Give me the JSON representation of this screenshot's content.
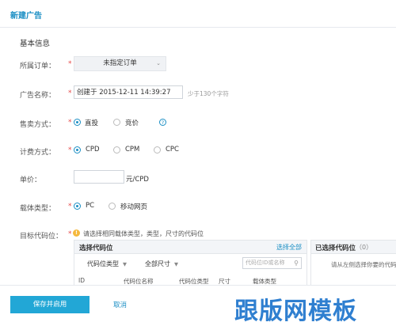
{
  "header": {
    "title": "新建广告"
  },
  "section_title": "基本信息",
  "form": {
    "order": {
      "label": "所属订单：",
      "required": "*",
      "value": "未指定订单",
      "caret": "⌄"
    },
    "ad_name": {
      "label": "广告名称：",
      "required": "*",
      "value": "创建于 2015-12-11 14:39:27",
      "hint": "少于130个字符"
    },
    "sale_method": {
      "label": "售卖方式：",
      "required": "*",
      "options": [
        "直投",
        "竞价"
      ],
      "selected": "直投",
      "help": "?"
    },
    "billing": {
      "label": "计费方式：",
      "required": "*",
      "options": [
        "CPD",
        "CPM",
        "CPC"
      ],
      "selected": "CPD"
    },
    "price": {
      "label": "单价：",
      "value": "",
      "unit": "元/CPD"
    },
    "media": {
      "label": "载体类型：",
      "required": "*",
      "options": [
        "PC",
        "移动网页"
      ],
      "selected": "PC"
    },
    "target": {
      "label": "目标代码位：",
      "required": "*",
      "warning": "!",
      "tip": "请选择相同载体类型，类型，尺寸的代码位"
    }
  },
  "select_panel": {
    "title": "选择代码位",
    "select_all": "选择全部",
    "type_dropdown": "代码位类型",
    "size_dropdown": "全部尺寸",
    "caret": "▼",
    "search_placeholder": "代码位ID或名称",
    "search_icon": "search-icon",
    "columns": [
      "ID",
      "代码位名称",
      "代码位类型",
      "尺寸",
      "载体类型"
    ]
  },
  "selected_panel": {
    "title": "已选择代码位",
    "count": "（0）",
    "message": "请从左侧选择你要的代码位"
  },
  "footer": {
    "submit": "保存并启用",
    "cancel": "取消"
  },
  "watermark": "跟版网模板",
  "colors": {
    "accent": "#1a8ec4",
    "primary_button": "#22a7d6",
    "required": "#e64a4a",
    "warning": "#f5b83d"
  }
}
